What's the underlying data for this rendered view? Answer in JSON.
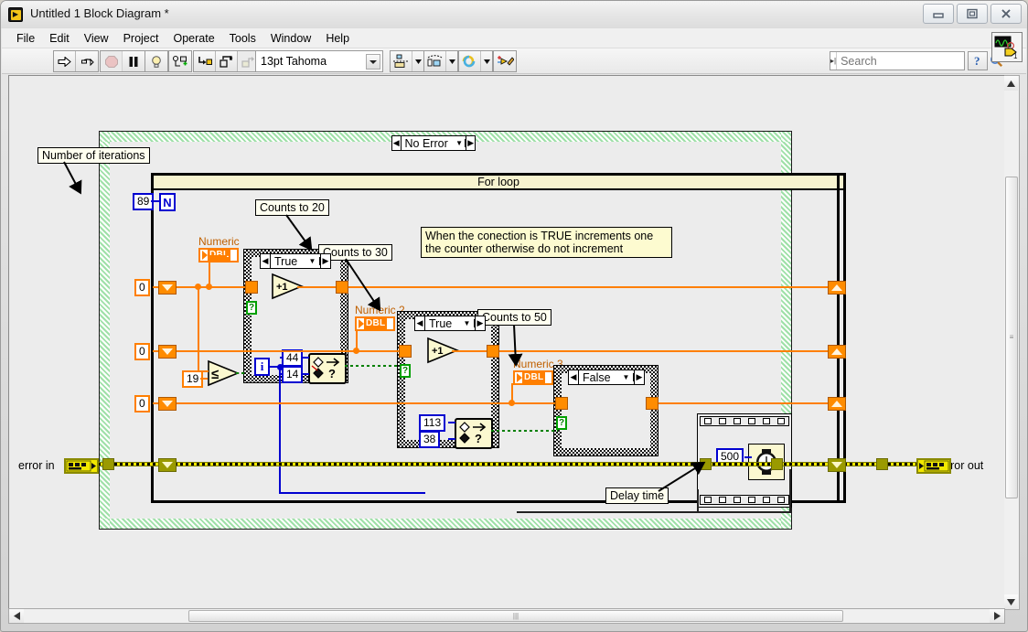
{
  "window": {
    "title": "Untitled 1 Block Diagram *",
    "app_icon": "labview-icon",
    "minimize": "minimize-icon",
    "maximize": "maximize-icon",
    "close": "close-icon"
  },
  "menu": {
    "items": [
      "File",
      "Edit",
      "View",
      "Project",
      "Operate",
      "Tools",
      "Window",
      "Help"
    ]
  },
  "toolbar": {
    "run": "run-arrow-icon",
    "run_continuously": "run-continuously-icon",
    "abort": "abort-execution-icon",
    "pause": "pause-icon",
    "highlight_execution": "lightbulb-icon",
    "retain_wire_values": "retain-wire-values-icon",
    "step_into": "step-into-icon",
    "step_over": "step-over-icon",
    "step_out": "step-out-icon",
    "font_value": "13pt Tahoma",
    "align_objects": "align-objects-icon",
    "distribute_objects": "distribute-objects-icon",
    "reorder": "reorder-icon",
    "clean_up_diagram": "clean-up-diagram-icon",
    "help_button": "help-question-icon",
    "context_help": "context-help-icon",
    "context_help_badge": "1"
  },
  "search": {
    "placeholder": "Search",
    "value": "",
    "icon": "magnifier-icon",
    "grip": "search-grip-icon"
  },
  "diagram": {
    "case_outer": {
      "selector_value": "No Error",
      "left_arrow": "prev-case-arrow",
      "right_arrow": "next-case-arrow",
      "dropdown": "chevron-down-icon"
    },
    "for_loop": {
      "label": "For loop",
      "count_terminal": "N",
      "count_value": "89",
      "iteration_terminal": "i"
    },
    "labels": {
      "number_of_iterations": "Number of iterations",
      "counts_to_20": "Counts to 20",
      "counts_to_30": "Counts to 30",
      "counts_to_50": "Counts to 50",
      "delay_time": "Delay time"
    },
    "comment": "When the conection is TRUE increments one the counter otherwise do not increment",
    "indicators": {
      "numeric_1": "Numeric",
      "numeric_2": "Numeric 2",
      "numeric_3": "Numeric 3",
      "dbl_type": "DBL"
    },
    "cases": [
      {
        "name": "case-counts-20",
        "selector_value": "True"
      },
      {
        "name": "case-counts-30",
        "selector_value": "True"
      },
      {
        "name": "case-counts-50",
        "selector_value": "False"
      }
    ],
    "constants": {
      "shift_reg_init_1": "0",
      "shift_reg_init_2": "0",
      "shift_reg_init_3": "0",
      "compare_limit": "19",
      "in_range_upper_1": "44",
      "in_range_lower_1": "14",
      "in_range_upper_2": "113",
      "in_range_lower_2": "38",
      "wait_ms": "500"
    },
    "functions": {
      "increment": "+1",
      "less_equal": "less-or-equal-icon",
      "in_range_and_coerce": "in-range-and-coerce-icon",
      "wait_ms_icon": "wait-clock-icon",
      "boolean_question": "?"
    },
    "terminals": {
      "error_in": "error in",
      "error_out": "error out"
    }
  },
  "scrollbars": {
    "vertical": "vertical-scrollbar",
    "horizontal": "horizontal-scrollbar",
    "up": "scroll-up-arrow",
    "down": "scroll-down-arrow",
    "left": "scroll-left-arrow",
    "right": "scroll-right-arrow"
  },
  "colors": {
    "numeric_wire": "#ff7f00",
    "boolean_wire": "#008000",
    "error_wire": "#f2e800",
    "integer_wire": "#0000d0",
    "case_border_green": "#9fe0a8"
  }
}
